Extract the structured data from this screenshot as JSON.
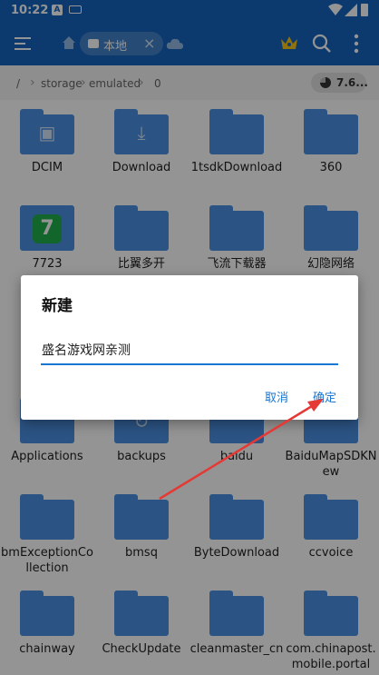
{
  "status_bar": {
    "time": "10:22",
    "icons": [
      "a-notification-icon",
      "keyboard-icon",
      "wifi-icon",
      "signal-icon",
      "battery-icon"
    ],
    "a_glyph": "A"
  },
  "toolbar": {
    "location_label": "本地",
    "icons": [
      "menu-icon",
      "home-icon",
      "close-icon",
      "cloud-icon",
      "crown-icon",
      "search-icon",
      "more-icon"
    ]
  },
  "path": {
    "root": "/",
    "crumbs": [
      "storage",
      "emulated",
      "0"
    ],
    "storage_usage": "7.6..."
  },
  "files": [
    {
      "name": "DCIM",
      "glyph": "camera-icon"
    },
    {
      "name": "Download",
      "glyph": "download-icon"
    },
    {
      "name": "1tsdkDownload",
      "glyph": ""
    },
    {
      "name": "360",
      "glyph": ""
    },
    {
      "name": "7723",
      "glyph": "app-icon"
    },
    {
      "name": "比翼多开",
      "glyph": ""
    },
    {
      "name": "飞流下载器",
      "glyph": ""
    },
    {
      "name": "幻隐网络",
      "glyph": ""
    },
    {
      "name": "Applications",
      "glyph": ""
    },
    {
      "name": "backups",
      "glyph": "backup-icon"
    },
    {
      "name": "baidu",
      "glyph": ""
    },
    {
      "name": "BaiduMapSDKNew",
      "glyph": ""
    },
    {
      "name": "bmExceptionCollection",
      "glyph": ""
    },
    {
      "name": "bmsq",
      "glyph": ""
    },
    {
      "name": "ByteDownload",
      "glyph": ""
    },
    {
      "name": "ccvoice",
      "glyph": ""
    },
    {
      "name": "chainway",
      "glyph": ""
    },
    {
      "name": "CheckUpdate",
      "glyph": ""
    },
    {
      "name": "cleanmaster_cn",
      "glyph": ""
    },
    {
      "name": "com.chinapost.mobile.portal",
      "glyph": ""
    }
  ],
  "dialog": {
    "title": "新建",
    "input_value": "盛名游戏网亲测",
    "cancel_label": "取消",
    "ok_label": "确定"
  },
  "colors": {
    "primary": "#1565c0",
    "folder": "#4a90e2",
    "accent": "#1976d2",
    "annotation_arrow": "#e53935"
  }
}
